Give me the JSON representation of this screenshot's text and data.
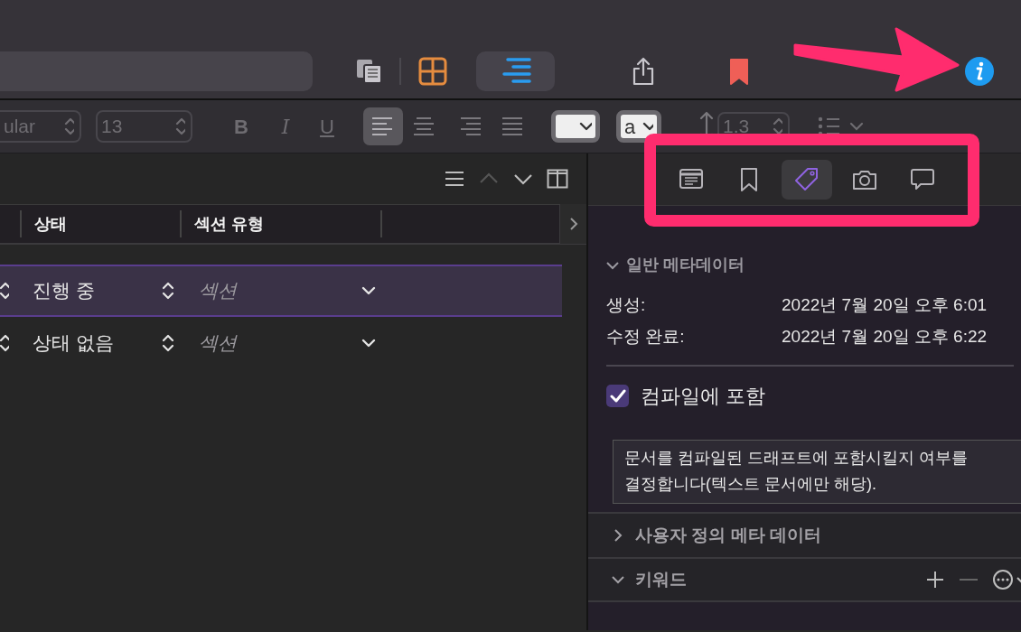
{
  "toolbar": {
    "view_modes": [
      {
        "kind": "corkboard",
        "selected": false
      },
      {
        "kind": "outliner",
        "selected": true
      }
    ]
  },
  "format_bar": {
    "font_style": "ular",
    "font_size": "13",
    "bold": "B",
    "italic": "I",
    "underline": "U",
    "text_color_letter": "a",
    "line_spacing": "1.3",
    "alignments": [
      {
        "kind": "left",
        "selected": true
      },
      {
        "kind": "center",
        "selected": false
      },
      {
        "kind": "right",
        "selected": false
      },
      {
        "kind": "justify",
        "selected": false
      }
    ]
  },
  "outliner": {
    "columns": [
      "상태",
      "섹션 유형"
    ],
    "rows": [
      {
        "status": "진행 중",
        "section_type": "섹션",
        "selected": true
      },
      {
        "status": "상태 없음",
        "section_type": "섹션",
        "selected": false
      }
    ]
  },
  "inspector": {
    "tabs": [
      {
        "kind": "notes",
        "selected": false
      },
      {
        "kind": "bookmarks",
        "selected": false
      },
      {
        "kind": "metadata",
        "selected": true
      },
      {
        "kind": "snapshots",
        "selected": false
      },
      {
        "kind": "comments",
        "selected": false
      }
    ],
    "general": {
      "title": "일반 메타데이터",
      "expanded": true,
      "fields": [
        {
          "label": "생성:",
          "value": "2022년 7월 20일 오후 6:01"
        },
        {
          "label": "수정 완료:",
          "value": "2022년 7월 20일 오후 6:22"
        }
      ]
    },
    "include_in_compile": {
      "label": "컴파일에 포함",
      "checked": true
    },
    "tooltip": "문서를 컴파일된 드래프트에 포함시킬지 여부를 결정합니다(텍스트 문서에만 해당).",
    "sections": [
      {
        "title": "사용자 정의 메타 데이터",
        "expanded": false,
        "kind": "plain"
      },
      {
        "title": "키워드",
        "expanded": true,
        "kind": "keywords"
      }
    ]
  },
  "annotation_arrow": true,
  "annotation_frame": true
}
